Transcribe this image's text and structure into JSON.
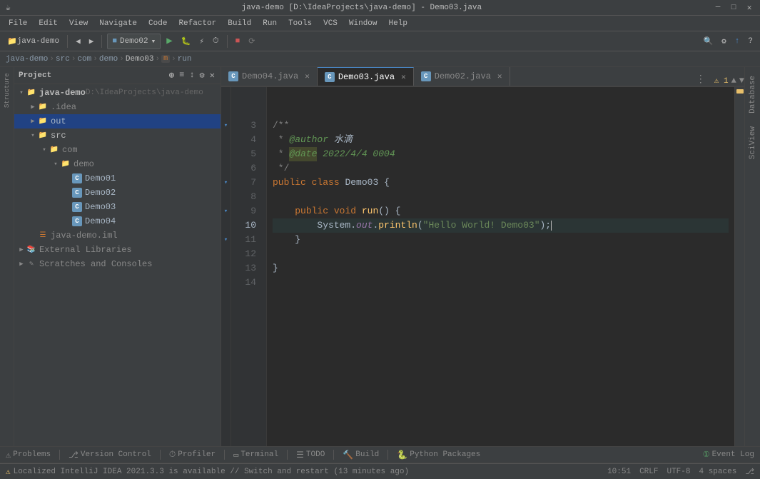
{
  "titlebar": {
    "title": "java-demo [D:\\IdeaProjects\\java-demo] - Demo03.java",
    "app_icon": "☕"
  },
  "menubar": {
    "items": [
      "File",
      "Edit",
      "View",
      "Navigate",
      "Code",
      "Refactor",
      "Build",
      "Run",
      "Tools",
      "VCS",
      "Window",
      "Help"
    ]
  },
  "toolbar": {
    "project_dropdown": "java-demo",
    "config_dropdown": "Demo02",
    "run_label": "▶",
    "search_icon": "🔍"
  },
  "breadcrumb": {
    "items": [
      "java-demo",
      "src",
      "com",
      "demo",
      "Demo03",
      "m",
      "run"
    ]
  },
  "project": {
    "title": "Project",
    "tree": [
      {
        "label": "java-demo  D:\\IdeaProjects\\java-demo",
        "level": 0,
        "type": "root",
        "expanded": true
      },
      {
        "label": ".idea",
        "level": 1,
        "type": "folder",
        "expanded": false
      },
      {
        "label": "out",
        "level": 1,
        "type": "folder",
        "expanded": false,
        "selected": true
      },
      {
        "label": "src",
        "level": 1,
        "type": "folder",
        "expanded": true
      },
      {
        "label": "com",
        "level": 2,
        "type": "folder",
        "expanded": true
      },
      {
        "label": "demo",
        "level": 3,
        "type": "folder",
        "expanded": true
      },
      {
        "label": "Demo01",
        "level": 4,
        "type": "class"
      },
      {
        "label": "Demo02",
        "level": 4,
        "type": "class"
      },
      {
        "label": "Demo03",
        "level": 4,
        "type": "class"
      },
      {
        "label": "Demo04",
        "level": 4,
        "type": "class"
      },
      {
        "label": "java-demo.iml",
        "level": 1,
        "type": "iml"
      },
      {
        "label": "External Libraries",
        "level": 0,
        "type": "lib",
        "expanded": false
      },
      {
        "label": "Scratches and Consoles",
        "level": 0,
        "type": "scratches",
        "expanded": false
      }
    ]
  },
  "tabs": [
    {
      "label": "Demo04.java",
      "active": false,
      "modified": false
    },
    {
      "label": "Demo03.java",
      "active": true,
      "modified": false
    },
    {
      "label": "Demo02.java",
      "active": false,
      "modified": false
    }
  ],
  "editor": {
    "filename": "Demo03.java",
    "lines": [
      {
        "num": 3,
        "text": "/**",
        "type": "comment"
      },
      {
        "num": 4,
        "text": " * @author 水滴",
        "type": "comment-author"
      },
      {
        "num": 5,
        "text": " * @date 2022/4/4 0004",
        "type": "comment-date"
      },
      {
        "num": 6,
        "text": " */",
        "type": "comment"
      },
      {
        "num": 7,
        "text": "public class Demo03 {",
        "type": "code"
      },
      {
        "num": 8,
        "text": "",
        "type": "empty"
      },
      {
        "num": 9,
        "text": "    public void run() {",
        "type": "code"
      },
      {
        "num": 10,
        "text": "        System.out.println(\"Hello World! Demo03\");",
        "type": "code"
      },
      {
        "num": 11,
        "text": "    }",
        "type": "code"
      },
      {
        "num": 12,
        "text": "",
        "type": "empty"
      },
      {
        "num": 13,
        "text": "}",
        "type": "code"
      },
      {
        "num": 14,
        "text": "",
        "type": "empty"
      }
    ]
  },
  "bottom_toolbar": {
    "items": [
      {
        "icon": "⚠",
        "label": "Problems"
      },
      {
        "icon": "⎇",
        "label": "Version Control"
      },
      {
        "icon": "⏱",
        "label": "Profiler"
      },
      {
        "icon": "▭",
        "label": "Terminal"
      },
      {
        "icon": "☰",
        "label": "TODO"
      },
      {
        "icon": "🔨",
        "label": "Build"
      },
      {
        "icon": "🐍",
        "label": "Python Packages"
      }
    ]
  },
  "statusbar": {
    "message": "Localized IntelliJ IDEA 2021.3.3 is available // Switch and restart (13 minutes ago)",
    "event_log": "Event Log",
    "line_col": "10:51",
    "line_sep": "CRLF",
    "encoding": "UTF-8",
    "indent": "4 spaces",
    "git_icon": "⎇",
    "warning_count": "1"
  },
  "colors": {
    "bg_dark": "#2b2b2b",
    "bg_panel": "#3c3f41",
    "bg_selected": "#214283",
    "accent_blue": "#4a88c7",
    "keyword": "#cc7832",
    "string": "#6a8759",
    "comment": "#808080",
    "function": "#ffc66d",
    "number": "#6897bb",
    "annotation": "#bbb529"
  }
}
